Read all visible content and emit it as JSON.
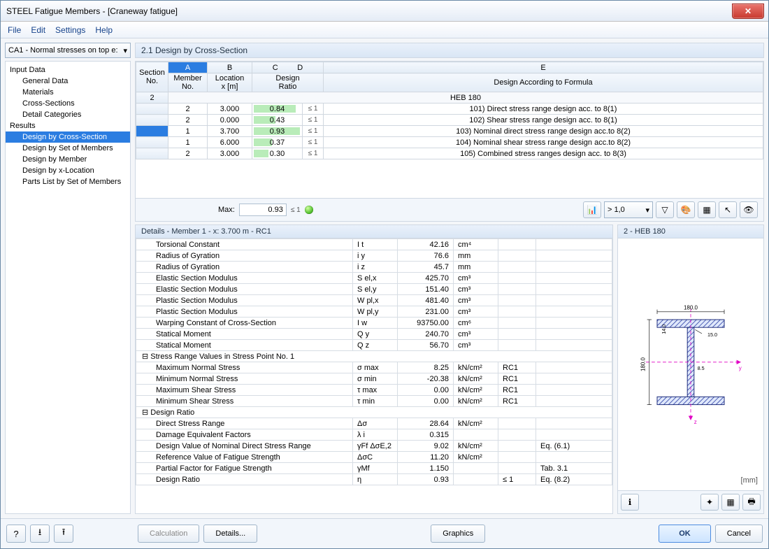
{
  "window": {
    "title": "STEEL Fatigue Members - [Craneway fatigue]"
  },
  "menus": [
    "File",
    "Edit",
    "Settings",
    "Help"
  ],
  "combo": {
    "text": "CA1 - Normal stresses on top e:"
  },
  "tree": {
    "root1": "Input Data",
    "items1": [
      "General Data",
      "Materials",
      "Cross-Sections",
      "Detail Categories"
    ],
    "root2": "Results",
    "items2": [
      "Design by Cross-Section",
      "Design by Set of Members",
      "Design by Member",
      "Design by x-Location",
      "Parts List by Set of Members"
    ],
    "selected": "Design by Cross-Section"
  },
  "panelTitle": "2.1 Design by Cross-Section",
  "gridHeader": {
    "cols": [
      "A",
      "B",
      "C",
      "D",
      "E"
    ],
    "section": "Section\nNo.",
    "member": "Member\nNo.",
    "location": "Location\nx [m]",
    "design": "Design\nRatio",
    "formula": "Design According to Formula"
  },
  "groupRow": {
    "section": "2",
    "label": "HEB 180"
  },
  "rows": [
    {
      "member": "2",
      "x": "3.000",
      "ratio": "0.84",
      "bar": 84,
      "leq": "≤ 1",
      "formula": "101) Direct stress range design acc. to 8(1)"
    },
    {
      "member": "2",
      "x": "0.000",
      "ratio": "0.43",
      "bar": 43,
      "leq": "≤ 1",
      "formula": "102) Shear stress range design acc. to 8(1)"
    },
    {
      "member": "1",
      "x": "3.700",
      "ratio": "0.93",
      "bar": 93,
      "leq": "≤ 1",
      "formula": "103) Nominal direct stress range design acc.to 8(2)",
      "sel": true
    },
    {
      "member": "1",
      "x": "6.000",
      "ratio": "0.37",
      "bar": 37,
      "leq": "≤ 1",
      "formula": "104) Nominal shear stress range design acc.to 8(2)"
    },
    {
      "member": "2",
      "x": "3.000",
      "ratio": "0.30",
      "bar": 30,
      "leq": "≤ 1",
      "formula": "105) Combined stress ranges design acc. to 8(3)"
    }
  ],
  "maxRow": {
    "label": "Max:",
    "value": "0.93",
    "leq": "≤ 1"
  },
  "scaleCombo": "> 1,0",
  "detailsTitle": "Details - Member 1 - x: 3.700 m - RC1",
  "details": [
    {
      "t": "row",
      "name": "Torsional Constant",
      "sym": "I t",
      "val": "42.16",
      "unit": "cm⁴"
    },
    {
      "t": "row",
      "name": "Radius of Gyration",
      "sym": "i y",
      "val": "76.6",
      "unit": "mm"
    },
    {
      "t": "row",
      "name": "Radius of Gyration",
      "sym": "i z",
      "val": "45.7",
      "unit": "mm"
    },
    {
      "t": "row",
      "name": "Elastic Section Modulus",
      "sym": "S el,x",
      "val": "425.70",
      "unit": "cm³"
    },
    {
      "t": "row",
      "name": "Elastic Section Modulus",
      "sym": "S el,y",
      "val": "151.40",
      "unit": "cm³"
    },
    {
      "t": "row",
      "name": "Plastic Section Modulus",
      "sym": "W pl,x",
      "val": "481.40",
      "unit": "cm³"
    },
    {
      "t": "row",
      "name": "Plastic Section Modulus",
      "sym": "W pl,y",
      "val": "231.00",
      "unit": "cm³"
    },
    {
      "t": "row",
      "name": "Warping Constant of Cross-Section",
      "sym": "I w",
      "val": "93750.00",
      "unit": "cm⁶"
    },
    {
      "t": "row",
      "name": "Statical Moment",
      "sym": "Q y",
      "val": "240.70",
      "unit": "cm³"
    },
    {
      "t": "row",
      "name": "Statical Moment",
      "sym": "Q z",
      "val": "56.70",
      "unit": "cm³"
    },
    {
      "t": "hdr",
      "name": "Stress Range Values in Stress Point No. 1"
    },
    {
      "t": "row",
      "name": "Maximum Normal Stress",
      "sym": "σ max",
      "val": "8.25",
      "unit": "kN/cm²",
      "note": "RC1"
    },
    {
      "t": "row",
      "name": "Minimum Normal Stress",
      "sym": "σ min",
      "val": "-20.38",
      "unit": "kN/cm²",
      "note": "RC1"
    },
    {
      "t": "row",
      "name": "Maximum Shear Stress",
      "sym": "τ max",
      "val": "0.00",
      "unit": "kN/cm²",
      "note": "RC1"
    },
    {
      "t": "row",
      "name": "Minimum Shear Stress",
      "sym": "τ min",
      "val": "0.00",
      "unit": "kN/cm²",
      "note": "RC1"
    },
    {
      "t": "hdr",
      "name": "Design Ratio"
    },
    {
      "t": "row",
      "name": "Direct Stress Range",
      "sym": "Δσ",
      "val": "28.64",
      "unit": "kN/cm²"
    },
    {
      "t": "row",
      "name": "Damage Equivalent Factors",
      "sym": "λ i",
      "val": "0.315",
      "unit": ""
    },
    {
      "t": "row",
      "name": "Design Value of Nominal Direct Stress Range",
      "sym": "γFf ΔσE,2",
      "val": "9.02",
      "unit": "kN/cm²",
      "ref": "Eq. (6.1)"
    },
    {
      "t": "row",
      "name": "Reference Value of Fatigue Strength",
      "sym": "ΔσC",
      "val": "11.20",
      "unit": "kN/cm²"
    },
    {
      "t": "row",
      "name": "Partial Factor for Fatigue Strength",
      "sym": "γMf",
      "val": "1.150",
      "unit": "",
      "ref": "Tab. 3.1"
    },
    {
      "t": "row",
      "name": "Design Ratio",
      "sym": "η",
      "val": "0.93",
      "unit": "",
      "note": "≤ 1",
      "ref": "Eq. (8.2)"
    }
  ],
  "sectionPanel": {
    "title": "2 - HEB 180",
    "unit": "[mm]",
    "dims": {
      "width": "180.0",
      "height": "180.0",
      "flange": "14.0",
      "radius": "15.0",
      "web": "8.5"
    }
  },
  "buttons": {
    "calculation": "Calculation",
    "details": "Details...",
    "graphics": "Graphics",
    "ok": "OK",
    "cancel": "Cancel"
  }
}
